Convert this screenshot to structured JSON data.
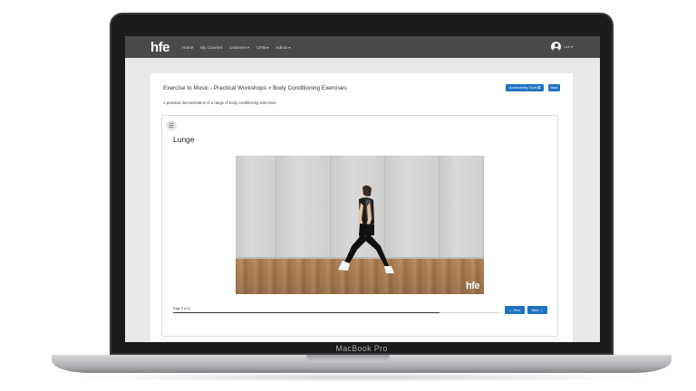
{
  "laptop": {
    "brand": "MacBook Pro"
  },
  "navbar": {
    "logo": "hfe",
    "items": [
      {
        "label": "Home",
        "caret": ""
      },
      {
        "label": "My Courses",
        "caret": ""
      },
      {
        "label": "Learners",
        "caret": "▾"
      },
      {
        "label": "CRM",
        "caret": "▾"
      },
      {
        "label": "Admin",
        "caret": "▾"
      }
    ],
    "user": {
      "name": "Lee ▾",
      "icon": "user-avatar-icon"
    }
  },
  "page": {
    "breadcrumb": "Exercise to Music - Practical Workshops > Body Conditioning Exercises",
    "accessibility_label": "Accessibility Tools ⧉",
    "back_label": "Back",
    "description": "A practical demonstration of a range of body conditioning exercises.",
    "menu_icon": "☰",
    "section_title": "Lunge",
    "video_watermark": "hfe",
    "progress": {
      "label": "Page 9 of 11",
      "fraction": 0.818
    },
    "prev_label": "← Prev",
    "next_label": "Next →"
  },
  "colors": {
    "accent": "#1f73c1",
    "navbar": "#4a4a4a"
  }
}
